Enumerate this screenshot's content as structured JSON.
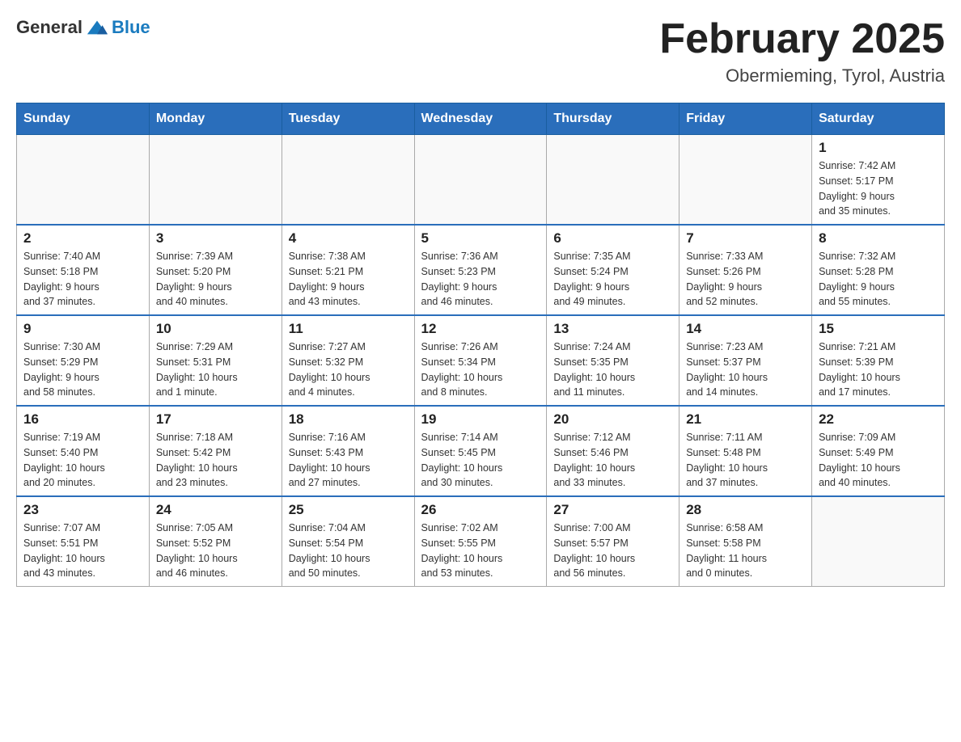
{
  "header": {
    "logo_general": "General",
    "logo_blue": "Blue",
    "month_title": "February 2025",
    "location": "Obermieming, Tyrol, Austria"
  },
  "weekdays": [
    "Sunday",
    "Monday",
    "Tuesday",
    "Wednesday",
    "Thursday",
    "Friday",
    "Saturday"
  ],
  "weeks": [
    {
      "days": [
        {
          "num": "",
          "info": ""
        },
        {
          "num": "",
          "info": ""
        },
        {
          "num": "",
          "info": ""
        },
        {
          "num": "",
          "info": ""
        },
        {
          "num": "",
          "info": ""
        },
        {
          "num": "",
          "info": ""
        },
        {
          "num": "1",
          "info": "Sunrise: 7:42 AM\nSunset: 5:17 PM\nDaylight: 9 hours\nand 35 minutes."
        }
      ]
    },
    {
      "days": [
        {
          "num": "2",
          "info": "Sunrise: 7:40 AM\nSunset: 5:18 PM\nDaylight: 9 hours\nand 37 minutes."
        },
        {
          "num": "3",
          "info": "Sunrise: 7:39 AM\nSunset: 5:20 PM\nDaylight: 9 hours\nand 40 minutes."
        },
        {
          "num": "4",
          "info": "Sunrise: 7:38 AM\nSunset: 5:21 PM\nDaylight: 9 hours\nand 43 minutes."
        },
        {
          "num": "5",
          "info": "Sunrise: 7:36 AM\nSunset: 5:23 PM\nDaylight: 9 hours\nand 46 minutes."
        },
        {
          "num": "6",
          "info": "Sunrise: 7:35 AM\nSunset: 5:24 PM\nDaylight: 9 hours\nand 49 minutes."
        },
        {
          "num": "7",
          "info": "Sunrise: 7:33 AM\nSunset: 5:26 PM\nDaylight: 9 hours\nand 52 minutes."
        },
        {
          "num": "8",
          "info": "Sunrise: 7:32 AM\nSunset: 5:28 PM\nDaylight: 9 hours\nand 55 minutes."
        }
      ]
    },
    {
      "days": [
        {
          "num": "9",
          "info": "Sunrise: 7:30 AM\nSunset: 5:29 PM\nDaylight: 9 hours\nand 58 minutes."
        },
        {
          "num": "10",
          "info": "Sunrise: 7:29 AM\nSunset: 5:31 PM\nDaylight: 10 hours\nand 1 minute."
        },
        {
          "num": "11",
          "info": "Sunrise: 7:27 AM\nSunset: 5:32 PM\nDaylight: 10 hours\nand 4 minutes."
        },
        {
          "num": "12",
          "info": "Sunrise: 7:26 AM\nSunset: 5:34 PM\nDaylight: 10 hours\nand 8 minutes."
        },
        {
          "num": "13",
          "info": "Sunrise: 7:24 AM\nSunset: 5:35 PM\nDaylight: 10 hours\nand 11 minutes."
        },
        {
          "num": "14",
          "info": "Sunrise: 7:23 AM\nSunset: 5:37 PM\nDaylight: 10 hours\nand 14 minutes."
        },
        {
          "num": "15",
          "info": "Sunrise: 7:21 AM\nSunset: 5:39 PM\nDaylight: 10 hours\nand 17 minutes."
        }
      ]
    },
    {
      "days": [
        {
          "num": "16",
          "info": "Sunrise: 7:19 AM\nSunset: 5:40 PM\nDaylight: 10 hours\nand 20 minutes."
        },
        {
          "num": "17",
          "info": "Sunrise: 7:18 AM\nSunset: 5:42 PM\nDaylight: 10 hours\nand 23 minutes."
        },
        {
          "num": "18",
          "info": "Sunrise: 7:16 AM\nSunset: 5:43 PM\nDaylight: 10 hours\nand 27 minutes."
        },
        {
          "num": "19",
          "info": "Sunrise: 7:14 AM\nSunset: 5:45 PM\nDaylight: 10 hours\nand 30 minutes."
        },
        {
          "num": "20",
          "info": "Sunrise: 7:12 AM\nSunset: 5:46 PM\nDaylight: 10 hours\nand 33 minutes."
        },
        {
          "num": "21",
          "info": "Sunrise: 7:11 AM\nSunset: 5:48 PM\nDaylight: 10 hours\nand 37 minutes."
        },
        {
          "num": "22",
          "info": "Sunrise: 7:09 AM\nSunset: 5:49 PM\nDaylight: 10 hours\nand 40 minutes."
        }
      ]
    },
    {
      "days": [
        {
          "num": "23",
          "info": "Sunrise: 7:07 AM\nSunset: 5:51 PM\nDaylight: 10 hours\nand 43 minutes."
        },
        {
          "num": "24",
          "info": "Sunrise: 7:05 AM\nSunset: 5:52 PM\nDaylight: 10 hours\nand 46 minutes."
        },
        {
          "num": "25",
          "info": "Sunrise: 7:04 AM\nSunset: 5:54 PM\nDaylight: 10 hours\nand 50 minutes."
        },
        {
          "num": "26",
          "info": "Sunrise: 7:02 AM\nSunset: 5:55 PM\nDaylight: 10 hours\nand 53 minutes."
        },
        {
          "num": "27",
          "info": "Sunrise: 7:00 AM\nSunset: 5:57 PM\nDaylight: 10 hours\nand 56 minutes."
        },
        {
          "num": "28",
          "info": "Sunrise: 6:58 AM\nSunset: 5:58 PM\nDaylight: 11 hours\nand 0 minutes."
        },
        {
          "num": "",
          "info": ""
        }
      ]
    }
  ]
}
